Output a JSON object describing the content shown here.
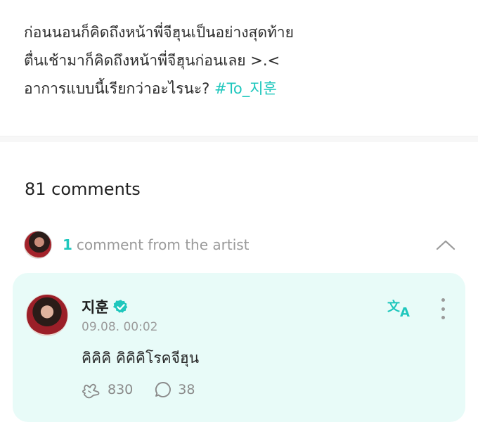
{
  "post": {
    "lines": [
      "ก่อนนอนก็คิดถึงหน้าพี่จีฮุนเป็นอย่างสุดท้าย",
      "ตื่นเช้ามาก็คิดถึงหน้าพี่จีฮุนก่อนเลย >.<",
      "อาการแบบนี้เรียกว่าอะไรนะ?"
    ],
    "hashtag": "#To_지훈"
  },
  "comments_count": "81 comments",
  "artist_section": {
    "count": "1",
    "label": "comment from the artist",
    "chevron_icon": "chevron-up-icon"
  },
  "artist_comment": {
    "name": "지훈",
    "verified_icon": "verified-badge-icon",
    "timestamp": "09.08. 00:02",
    "text": "คิคิคิ คิคิคิโรคจีฮุน",
    "likes": "830",
    "replies": "38",
    "like_icon": "heart-hands-icon",
    "reply_icon": "speech-bubble-icon",
    "translate_icon": "translate-icon",
    "more_icon": "more-vertical-icon"
  },
  "colors": {
    "accent": "#1fc7bd",
    "card_bg": "#e8fbf8",
    "muted": "#9a9a9a"
  }
}
